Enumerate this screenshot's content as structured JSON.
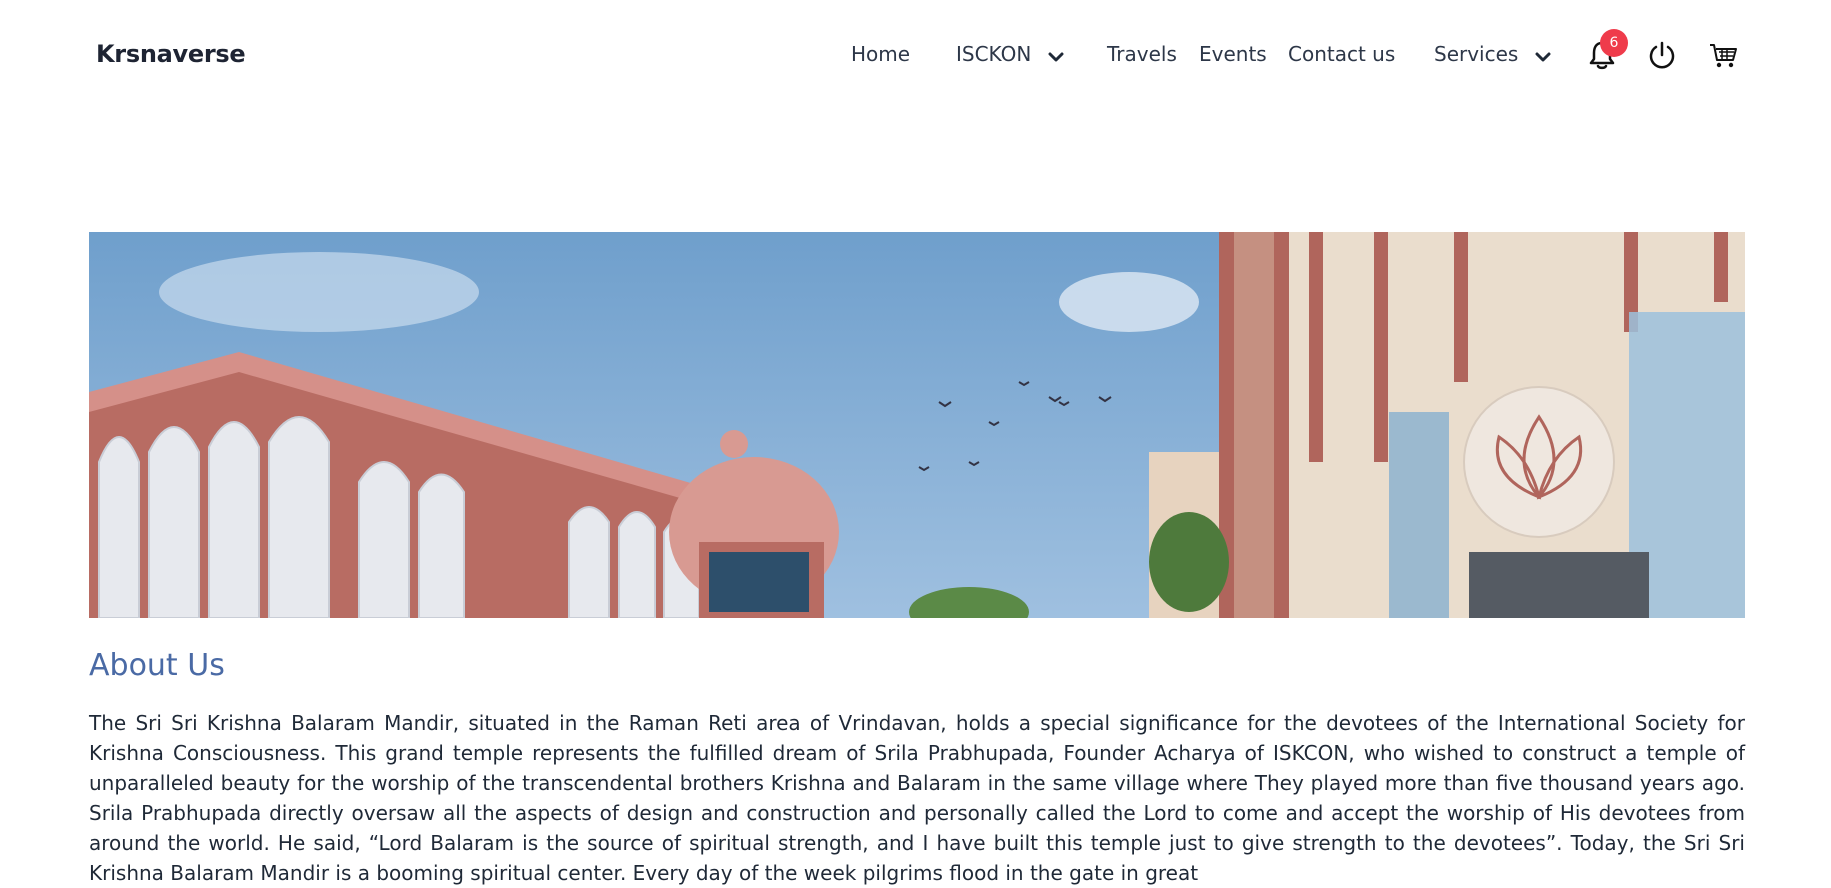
{
  "header": {
    "brand": "Krsnaverse",
    "nav": {
      "home": "Home",
      "iskcon": "ISCKON",
      "travels": "Travels",
      "events": "Events",
      "contact": "Contact us",
      "services": "Services"
    },
    "notifications_count": "6",
    "icons": [
      "bell-icon",
      "power-icon",
      "cart-icon",
      "chevron-down-icon"
    ]
  },
  "hero": {
    "image": "temple-architecture-banner"
  },
  "about": {
    "title": "About Us",
    "text": "The Sri Sri Krishna Balaram Mandir, situated in the Raman Reti area of Vrindavan, holds a special significance for the devotees of the International Society for Krishna Consciousness. This grand temple represents the fulfilled dream of Srila Prabhupada, Founder Acharya of ISKCON, who wished to construct a temple of unparalleled beauty for the worship of the transcendental brothers Krishna and Balaram in the same village where They played more than five thousand years ago. Srila Prabhupada directly oversaw all the aspects of design and construction and personally called the Lord to come and accept the worship of His devotees from around the world. He said, “Lord Balaram is the source of spiritual strength, and I have built this temple just to give strength to the devotees”. Today, the Sri Sri Krishna Balaram Mandir is a booming spiritual center. Every day of the week pilgrims flood in the gate in great"
  },
  "colors": {
    "accent": "#4a6aa5",
    "badge": "#ef3b4b",
    "text": "#1f2937"
  }
}
